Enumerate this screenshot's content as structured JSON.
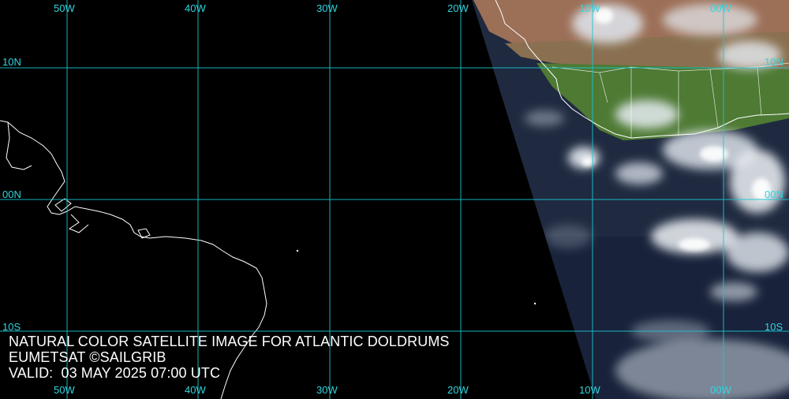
{
  "caption": {
    "title": "NATURAL COLOR SATELLITE IMAGE FOR ATLANTIC DOLDRUMS",
    "credit": "EUMETSAT ©SAILGRIB",
    "valid": "VALID:  03 MAY 2025 07:00 UTC"
  },
  "grid": {
    "longitude_labels": [
      "50W",
      "40W",
      "30W",
      "20W",
      "10W",
      "00W"
    ],
    "latitude_labels": [
      "10N",
      "00N",
      "10S"
    ],
    "line_color": "#19c7d2",
    "label_color": "#2fd6e0"
  },
  "colors": {
    "background": "#000000",
    "coastline": "#ffffff",
    "land": "#5a7a3c",
    "desert": "#a47358",
    "ocean": "#1f2a40",
    "cloud": "#e6ecf2"
  }
}
